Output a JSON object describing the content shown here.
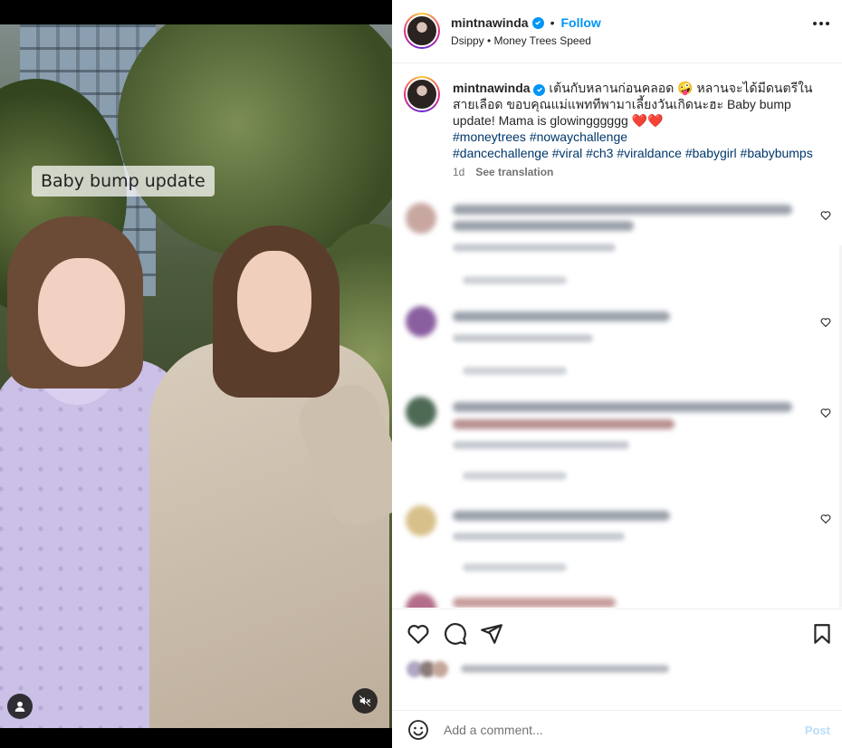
{
  "post": {
    "username": "mintnawinda",
    "follow_label": "Follow",
    "separator": "•",
    "audio": "Dsippy • Money Trees Speed",
    "video_caption_tag": "Baby bump update",
    "caption": {
      "username": "mintnawinda",
      "text": "เต้นกับหลานก่อนคลอด 🤪 หลานจะได้มีดนตรีในสายเลือด ขอบคุณแม่แพททีพามาเลี้ยงวันเกิดนะฮะ Baby bump update! Mama is glowingggggg ❤️❤️",
      "hashtags_line1": "#moneytrees #nowaychallenge",
      "hashtags_line2": "#dancechallenge #viral #ch3 #viraldance #babygirl #babybumps",
      "age": "1d",
      "see_translation": "See translation"
    },
    "comment_box": {
      "placeholder": "Add a comment...",
      "post_label": "Post"
    }
  },
  "icons": {
    "like": "heart-outline-icon",
    "comment": "speech-bubble-icon",
    "share": "paper-plane-icon",
    "save": "bookmark-icon",
    "emoji": "smiley-icon",
    "more": "ellipsis-icon",
    "mute": "speaker-muted-icon",
    "tagged_user": "user-icon"
  },
  "colors": {
    "accent": "#0095f6",
    "link": "#00376b",
    "muted_text": "#737373",
    "post_disabled": "#b7ddfb"
  }
}
